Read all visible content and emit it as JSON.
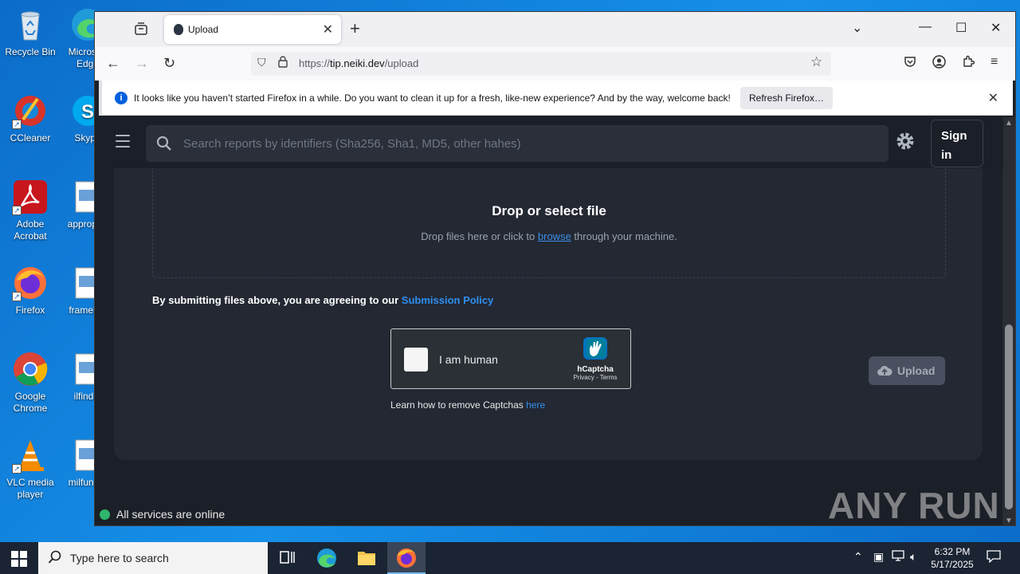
{
  "desktop": {
    "icons": [
      {
        "label": "Recycle Bin"
      },
      {
        "label": "Microsoft Edge"
      },
      {
        "label": "CCleaner"
      },
      {
        "label": "Skype"
      },
      {
        "label": "Adobe Acrobat"
      },
      {
        "label": "appropr..."
      },
      {
        "label": "Firefox"
      },
      {
        "label": "frameb..."
      },
      {
        "label": "Google Chrome"
      },
      {
        "label": "ilfind..."
      },
      {
        "label": "VLC media player"
      },
      {
        "label": "milfund..."
      }
    ]
  },
  "browser": {
    "tab_title": "Upload",
    "url_host": "tip.neiki.dev",
    "url_prefix": "https://",
    "url_path": "/upload",
    "notification": {
      "message": "It looks like you haven’t started Firefox in a while. Do you want to clean it up for a fresh, like-new experience? And by the way, welcome back!",
      "button": "Refresh Firefox…"
    }
  },
  "page": {
    "search_placeholder": "Search reports by identifiers (Sha256, Sha1, MD5, other hahes)",
    "signin": "Sign in",
    "dropzone": {
      "title": "Drop or select file",
      "sub_before": "Drop files here or click to ",
      "sub_link": "browse",
      "sub_after": " through your machine."
    },
    "policy_text": "By submitting files above, you are agreeing to our ",
    "policy_link": "Submission Policy",
    "captcha": {
      "label": "I am human",
      "brand": "hCaptcha",
      "links": "Privacy - Terms"
    },
    "learn_text": "Learn how to remove Captchas ",
    "learn_link": "here",
    "upload_button": "Upload",
    "status": "All services are online",
    "watermark": "ANY RUN"
  },
  "taskbar": {
    "search_placeholder": "Type here to search",
    "time": "6:32 PM",
    "date": "5/17/2025"
  },
  "colors": {
    "accent_link": "#2f8ff0",
    "page_bg": "#1b1f27",
    "card_bg": "#232833",
    "status_ok": "#2fb56c"
  }
}
